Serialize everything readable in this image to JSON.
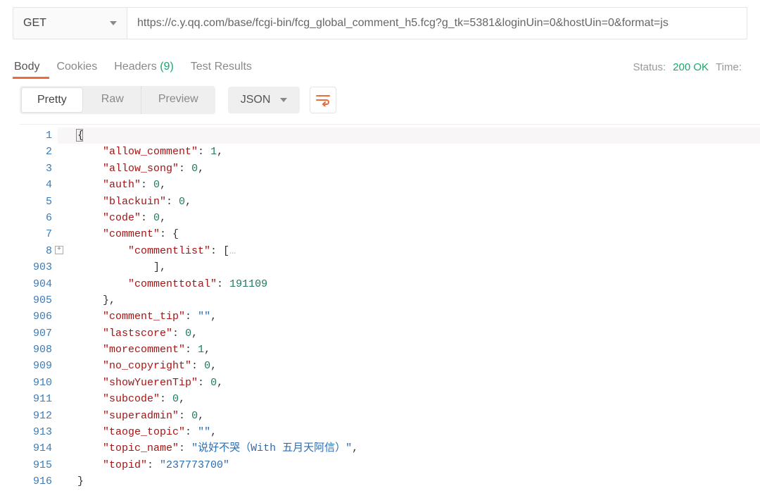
{
  "request": {
    "method": "GET",
    "url": "https://c.y.qq.com/base/fcgi-bin/fcg_global_comment_h5.fcg?g_tk=5381&loginUin=0&hostUin=0&format=js"
  },
  "responseTabs": {
    "body": "Body",
    "cookies": "Cookies",
    "headers": "Headers",
    "headersCount": "(9)",
    "testResults": "Test Results",
    "statusLabel": "Status:",
    "statusCode": "200 OK",
    "timeLabel": "Time:"
  },
  "viewModes": {
    "pretty": "Pretty",
    "raw": "Raw",
    "preview": "Preview"
  },
  "formatSelect": "JSON",
  "gutter": [
    "1",
    "2",
    "3",
    "4",
    "5",
    "6",
    "7",
    "8",
    "903",
    "904",
    "905",
    "906",
    "907",
    "908",
    "909",
    "910",
    "911",
    "912",
    "913",
    "914",
    "915",
    "916"
  ],
  "json": {
    "allow_comment": 1,
    "allow_song": 0,
    "auth": 0,
    "blackuin": 0,
    "code": 0,
    "comment": {
      "commentlist": "[…]",
      "commenttotal": 191109
    },
    "comment_tip": "",
    "lastscore": 0,
    "morecomment": 1,
    "no_copyright": 0,
    "showYuerenTip": 0,
    "subcode": 0,
    "superadmin": 0,
    "taoge_topic": "",
    "topic_name": "说好不哭（With 五月天阿信）",
    "topid": "237773700"
  }
}
